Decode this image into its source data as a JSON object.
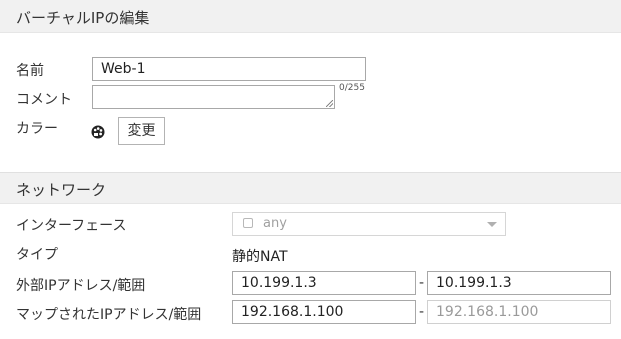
{
  "header": {
    "title": "バーチャルIPの編集"
  },
  "form": {
    "name": {
      "label": "名前",
      "value": "Web-1"
    },
    "comment": {
      "label": "コメント",
      "value": "",
      "counter": "0/255"
    },
    "color": {
      "label": "カラー",
      "icon": "palette-icon",
      "button_label": "変更"
    }
  },
  "network": {
    "title": "ネットワーク",
    "interface": {
      "label": "インターフェース",
      "value": "any"
    },
    "type": {
      "label": "タイプ",
      "value": "静的NAT"
    },
    "external": {
      "label": "外部IPアドレス/範囲",
      "from": "10.199.1.3",
      "to": "10.199.1.3"
    },
    "mapped": {
      "label": "マップされたIPアドレス/範囲",
      "from": "192.168.1.100",
      "to": "192.168.1.100"
    }
  },
  "range_separator": "-"
}
